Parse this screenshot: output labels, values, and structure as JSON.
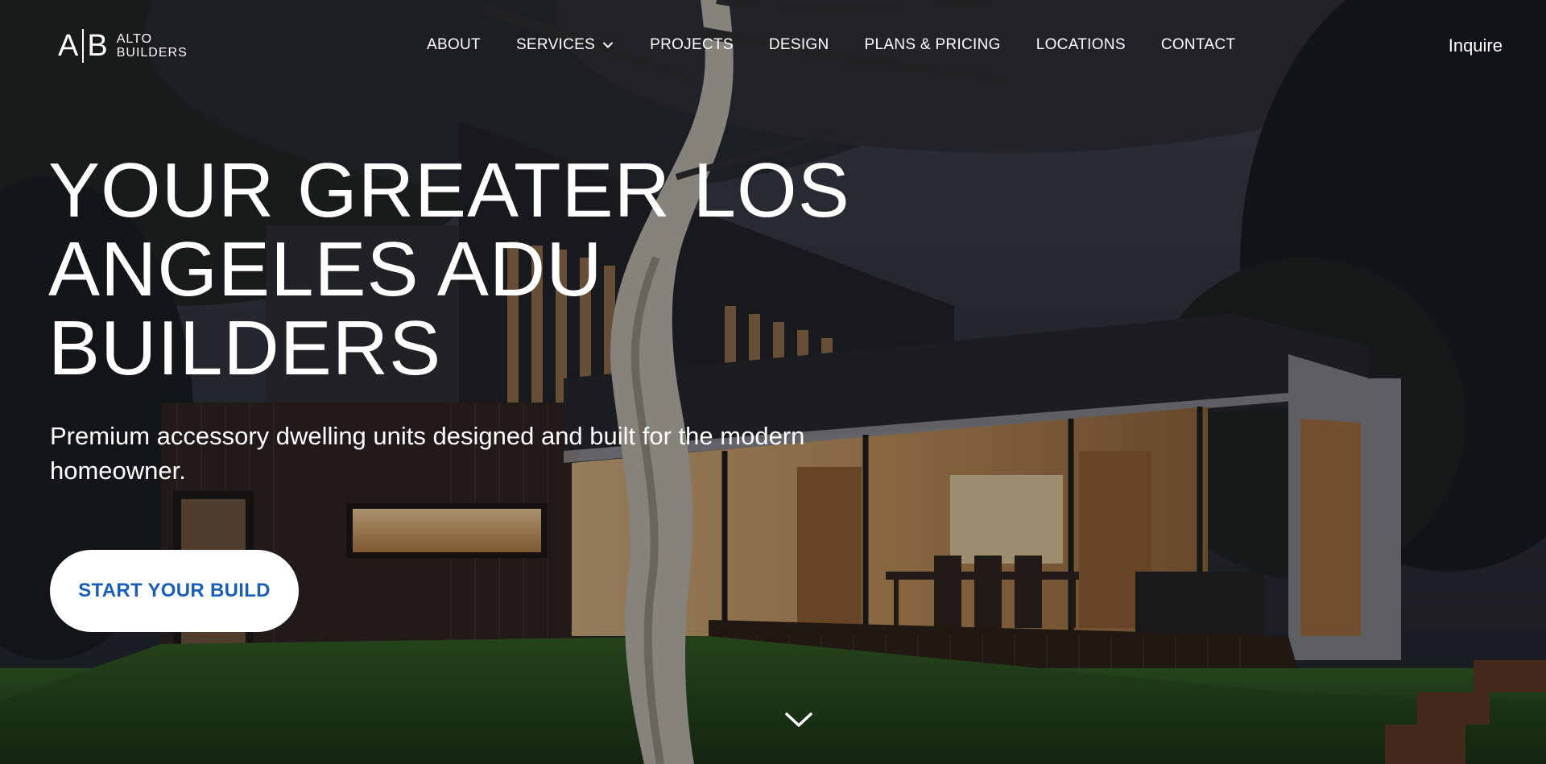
{
  "brand": {
    "logo_mark_left": "A",
    "logo_mark_right": "B",
    "logo_line1": "ALTO",
    "logo_line2": "BUILDERS"
  },
  "nav": {
    "items": [
      {
        "label": "ABOUT",
        "has_dropdown": false
      },
      {
        "label": "SERVICES",
        "has_dropdown": true
      },
      {
        "label": "PROJECTS",
        "has_dropdown": false
      },
      {
        "label": "DESIGN",
        "has_dropdown": false
      },
      {
        "label": "PLANS & PRICING",
        "has_dropdown": false
      },
      {
        "label": "LOCATIONS",
        "has_dropdown": false
      },
      {
        "label": "CONTACT",
        "has_dropdown": false
      }
    ],
    "inquire_label": "Inquire"
  },
  "hero": {
    "headline": "YOUR GREATER LOS ANGELES ADU BUILDERS",
    "subhead": "Premium accessory dwelling units designed and built for the modern homeowner.",
    "cta_label": "START YOUR BUILD"
  },
  "icons": {
    "services_dropdown": "chevron-down-icon",
    "scroll_down": "chevron-down-icon"
  },
  "colors": {
    "cta_text": "#1a5fb4",
    "cta_background": "#ffffff",
    "text": "#ffffff"
  }
}
